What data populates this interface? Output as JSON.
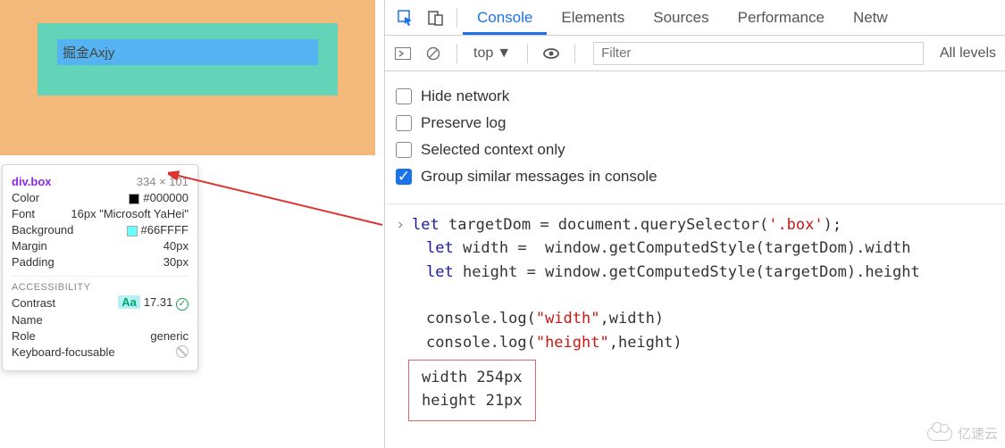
{
  "rendered": {
    "box_text": "掘金Axjy"
  },
  "tooltip": {
    "selector": "div.box",
    "dimensions": "334 × 101",
    "rows": {
      "color_label": "Color",
      "color_value": "#000000",
      "color_swatch": "#000000",
      "font_label": "Font",
      "font_value": "16px \"Microsoft YaHei\"",
      "bg_label": "Background",
      "bg_value": "#66FFFF",
      "bg_swatch": "#66FFFF",
      "margin_label": "Margin",
      "margin_value": "40px",
      "padding_label": "Padding",
      "padding_value": "30px"
    },
    "a11y_header": "ACCESSIBILITY",
    "a11y": {
      "contrast_label": "Contrast",
      "contrast_badge": "Aa",
      "contrast_value": "17.31",
      "name_label": "Name",
      "role_label": "Role",
      "role_value": "generic",
      "kf_label": "Keyboard-focusable"
    }
  },
  "devtools": {
    "tabs": {
      "console": "Console",
      "elements": "Elements",
      "sources": "Sources",
      "performance": "Performance",
      "network": "Netw"
    },
    "toolbar": {
      "top": "top",
      "filter_placeholder": "Filter",
      "levels": "All levels"
    },
    "options": {
      "hide_network": "Hide network",
      "preserve_log": "Preserve log",
      "selected_context": "Selected context only",
      "group_similar": "Group similar messages in console"
    },
    "code": {
      "l1a": "let",
      "l1b": " targetDom ",
      "l1c": "=",
      "l1d": " document.querySelector(",
      "l1e": "'.box'",
      "l1f": ");",
      "l2a": "let",
      "l2b": " width ",
      "l2c": "=",
      "l2d": "  window.getComputedStyle(targetDom).width",
      "l3a": "let",
      "l3b": " height ",
      "l3c": "=",
      "l3d": " window.getComputedStyle(targetDom).height",
      "l5a": "console.log(",
      "l5b": "\"width\"",
      "l5c": ",width)",
      "l6a": "console.log(",
      "l6b": "\"height\"",
      "l6c": ",height)"
    },
    "output": {
      "w_label": "width ",
      "w_val": "254px",
      "h_label": "height ",
      "h_val": "21px"
    }
  },
  "watermark": "亿速云"
}
